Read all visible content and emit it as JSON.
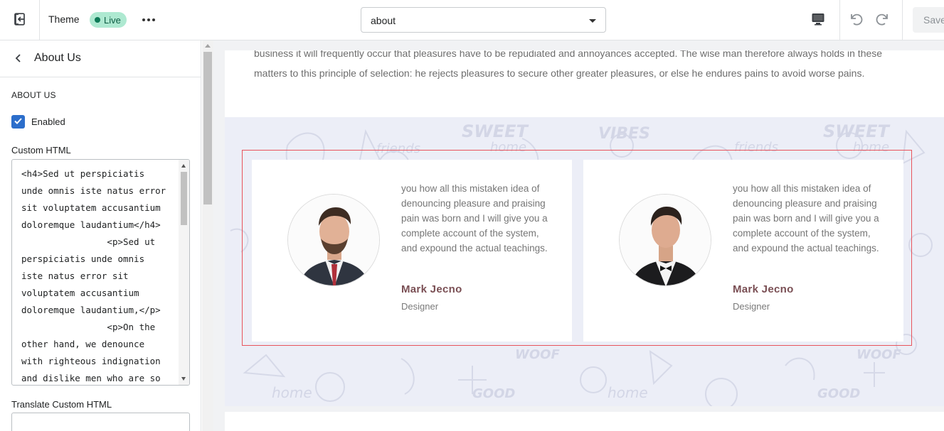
{
  "topbar": {
    "theme_label": "Theme",
    "live_badge": "Live",
    "page_select_value": "about",
    "save_label": "Save"
  },
  "sidebar": {
    "title": "About Us",
    "section_heading": "ABOUT US",
    "enabled_label": "Enabled",
    "enabled_checked": true,
    "custom_html_label": "Custom HTML",
    "custom_html_value": "<h4>Sed ut perspiciatis unde omnis iste natus error sit voluptatem accusantium doloremque laudantium</h4>\n                <p>Sed ut perspiciatis unde omnis iste natus error sit voluptatem accusantium doloremque laudantium,</p>\n                <p>On the other hand, we denounce with righteous indignation and dislike men who are so",
    "translate_label": "Translate Custom HTML",
    "translate_value": ""
  },
  "preview": {
    "intro_line_1": "business it will frequently occur that pleasures have to be repudiated and annoyances accepted. The wise man therefore always holds in these",
    "intro_line_2": "matters to this principle of selection: he rejects pleasures to secure other greater pleasures, or else he endures pains to avoid worse pains.",
    "pattern_words": [
      "VIBES",
      "SWEET",
      "home",
      "friends",
      "WOOF",
      "GOOD",
      "home"
    ],
    "testimonials": [
      {
        "quote": "you how all this mistaken idea of denouncing pleasure and praising pain was born and I will give you a complete account of the system, and expound the actual teachings.",
        "name": "Mark Jecno",
        "role": "Designer"
      },
      {
        "quote": "you how all this mistaken idea of denouncing pleasure and praising pain was born and I will give you a complete account of the system, and expound the actual teachings.",
        "name": "Mark Jecno",
        "role": "Designer"
      }
    ]
  },
  "icons": {
    "exit": "exit-icon",
    "more": "more-horizontal-icon",
    "desktop": "desktop-icon",
    "undo": "undo-icon",
    "redo": "redo-icon",
    "back": "chevron-left-icon",
    "check": "checkmark-icon"
  },
  "colors": {
    "live_badge_bg": "#aee9d1",
    "checkbox": "#2c6ecb",
    "selection_border": "#e8545c",
    "name_text": "#7a4f54",
    "pattern_bg": "#eceef7"
  }
}
